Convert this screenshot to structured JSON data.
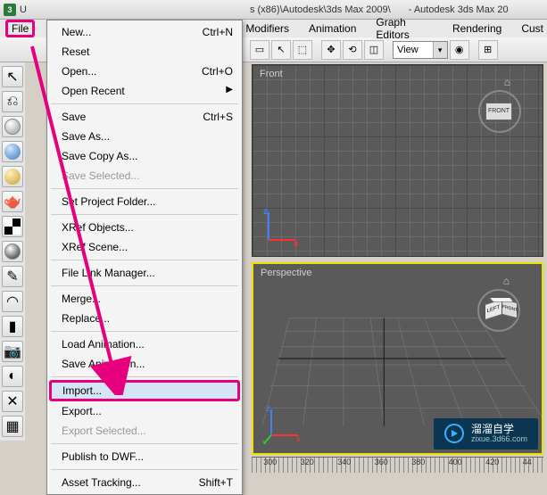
{
  "title_parts": {
    "prefix": "U",
    "path": "s (x86)\\Autodesk\\3ds Max 2009\\",
    "app": "- Autodesk 3ds Max 20"
  },
  "menubar": {
    "file": "File",
    "modifiers": "Modifiers",
    "animation": "Animation",
    "graph": "Graph Editors",
    "rendering": "Rendering",
    "cust": "Cust"
  },
  "toolbar": {
    "view_label": "View"
  },
  "file_menu": {
    "new": "New...",
    "new_sc": "Ctrl+N",
    "reset": "Reset",
    "open": "Open...",
    "open_sc": "Ctrl+O",
    "open_recent": "Open Recent",
    "save": "Save",
    "save_sc": "Ctrl+S",
    "save_as": "Save As...",
    "save_copy": "Save Copy As...",
    "save_selected": "Save Selected...",
    "set_project": "Set Project Folder...",
    "xref_obj": "XRef Objects...",
    "xref_scene": "XRef Scene...",
    "file_link": "File Link Manager...",
    "merge": "Merge...",
    "replace": "Replace...",
    "load_anim": "Load Animation...",
    "save_anim": "Save Animation...",
    "import": "Import...",
    "export": "Export...",
    "export_sel": "Export Selected...",
    "publish_dwf": "Publish to DWF...",
    "asset_track": "Asset Tracking...",
    "asset_sc": "Shift+T"
  },
  "viewports": {
    "front": "Front",
    "front_badge": "FRONT",
    "perspective": "Perspective",
    "cube_left": "LEFT",
    "cube_front": "FRONT"
  },
  "axes": {
    "x": "x",
    "y": "y",
    "z": "z"
  },
  "watermark": {
    "brand": "溜溜自学",
    "url": "zixue.3d66.com"
  },
  "ruler": {
    "ticks": [
      "300",
      "320",
      "340",
      "360",
      "380",
      "400",
      "420",
      "44"
    ]
  }
}
